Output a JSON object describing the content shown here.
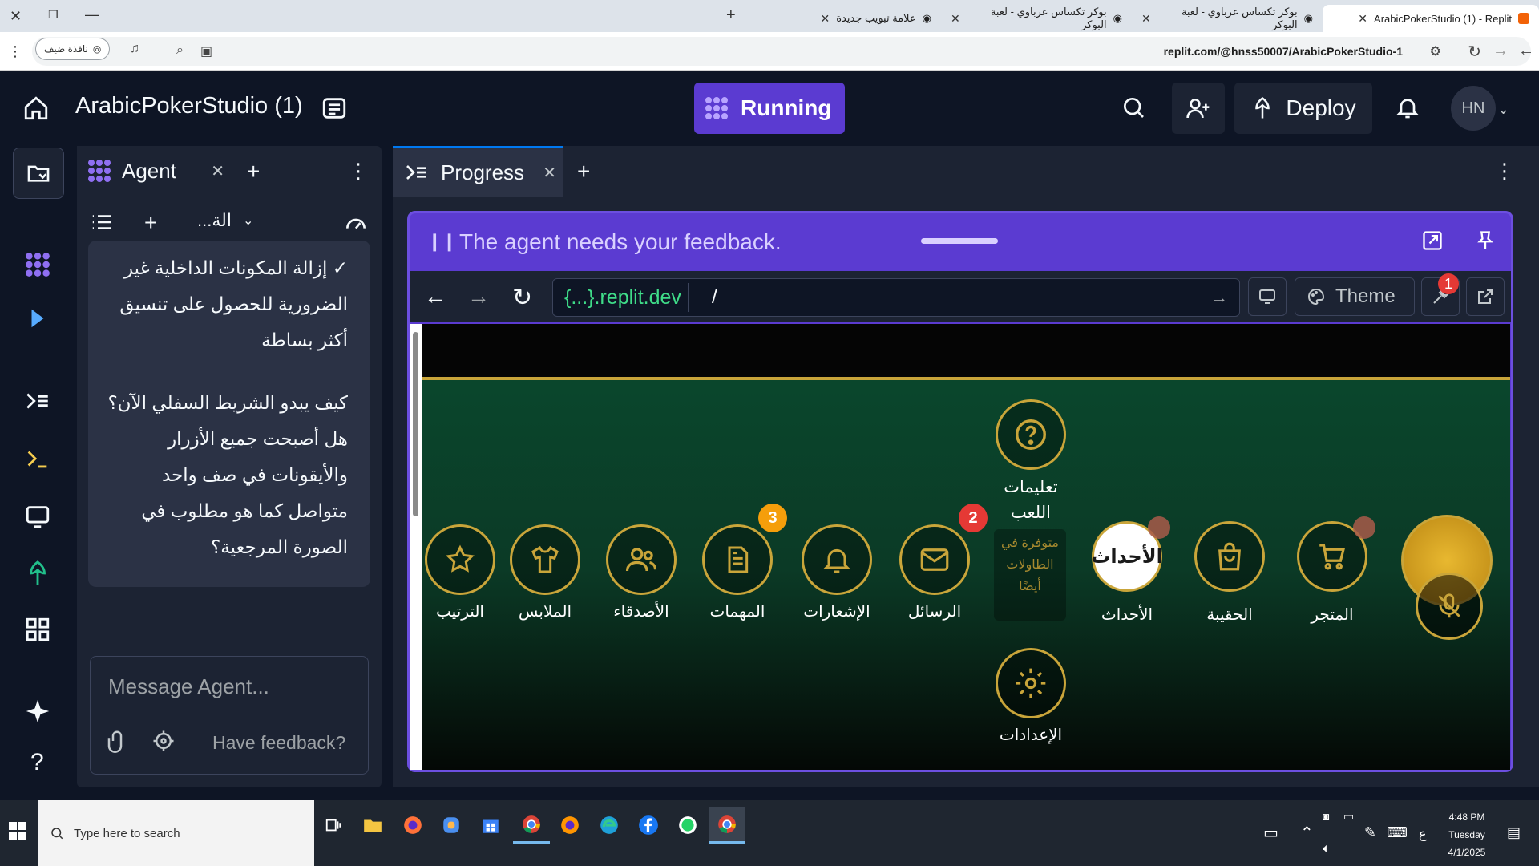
{
  "browser": {
    "tabs": [
      {
        "title": "ArabicPokerStudio (1) - Replit",
        "active": true
      },
      {
        "title": "بوكر تكساس عرباوي - لعبة البوكر",
        "active": false
      },
      {
        "title": "بوكر تكساس عرباوي - لعبة البوكر",
        "active": false
      },
      {
        "title": "علامة تبويب جديدة",
        "active": false
      }
    ],
    "url": "replit.com/@hnss50007/ArabicPokerStudio-1",
    "guest_label": "نافذة ضيف"
  },
  "header": {
    "project_title": "ArabicPokerStudio (1)",
    "run_label": "Running",
    "deploy_label": "Deploy",
    "avatar_initials": "HN"
  },
  "agent_panel": {
    "tab_label": "Agent",
    "thread_label": "...الة",
    "messages": [
      "✓ إزالة المكونات الداخلية غير الضرورية للحصول على تنسيق أكثر بساطة",
      "كيف يبدو الشريط السفلي الآن؟ هل أصبحت جميع الأزرار والأيقونات في صف واحد متواصل كما هو مطلوب في الصورة المرجعية؟"
    ],
    "input_placeholder": "Message Agent...",
    "feedback_link": "Have feedback?"
  },
  "progress_panel": {
    "tab_label": "Progress",
    "feedback_banner": "The agent needs your feedback.",
    "preview_domain": "{...}.replit.dev",
    "preview_path": "/",
    "theme_label": "Theme",
    "devtools_badge": "1"
  },
  "game": {
    "help_label": "تعليمات اللعب",
    "help_note": "متوفرة في الطاولات أيضًا",
    "settings_label": "الإعدادات",
    "events_logo_text": "الأحداث",
    "buttons": [
      {
        "label": "الترتيب",
        "icon": "star-icon"
      },
      {
        "label": "الملابس",
        "icon": "shirt-icon"
      },
      {
        "label": "الأصدقاء",
        "icon": "friends-icon"
      },
      {
        "label": "المهمات",
        "icon": "tasks-icon",
        "badge": "3"
      },
      {
        "label": "الإشعارات",
        "icon": "bell-icon"
      },
      {
        "label": "الرسائل",
        "icon": "mail-icon",
        "badge": "2"
      },
      {
        "label": "الأحداث",
        "icon": "events-icon"
      },
      {
        "label": "الحقيبة",
        "icon": "bag-icon"
      },
      {
        "label": "المتجر",
        "icon": "cart-icon"
      }
    ],
    "colors": {
      "gold": "#c9a53a",
      "badge_orange": "#f59e0b",
      "badge_red": "#e53935",
      "felt": "#0a4a2e"
    }
  },
  "taskbar": {
    "search_placeholder": "Type here to search",
    "time": "4:48 PM",
    "day": "Tuesday",
    "date": "4/1/2025",
    "lang": "ع"
  }
}
